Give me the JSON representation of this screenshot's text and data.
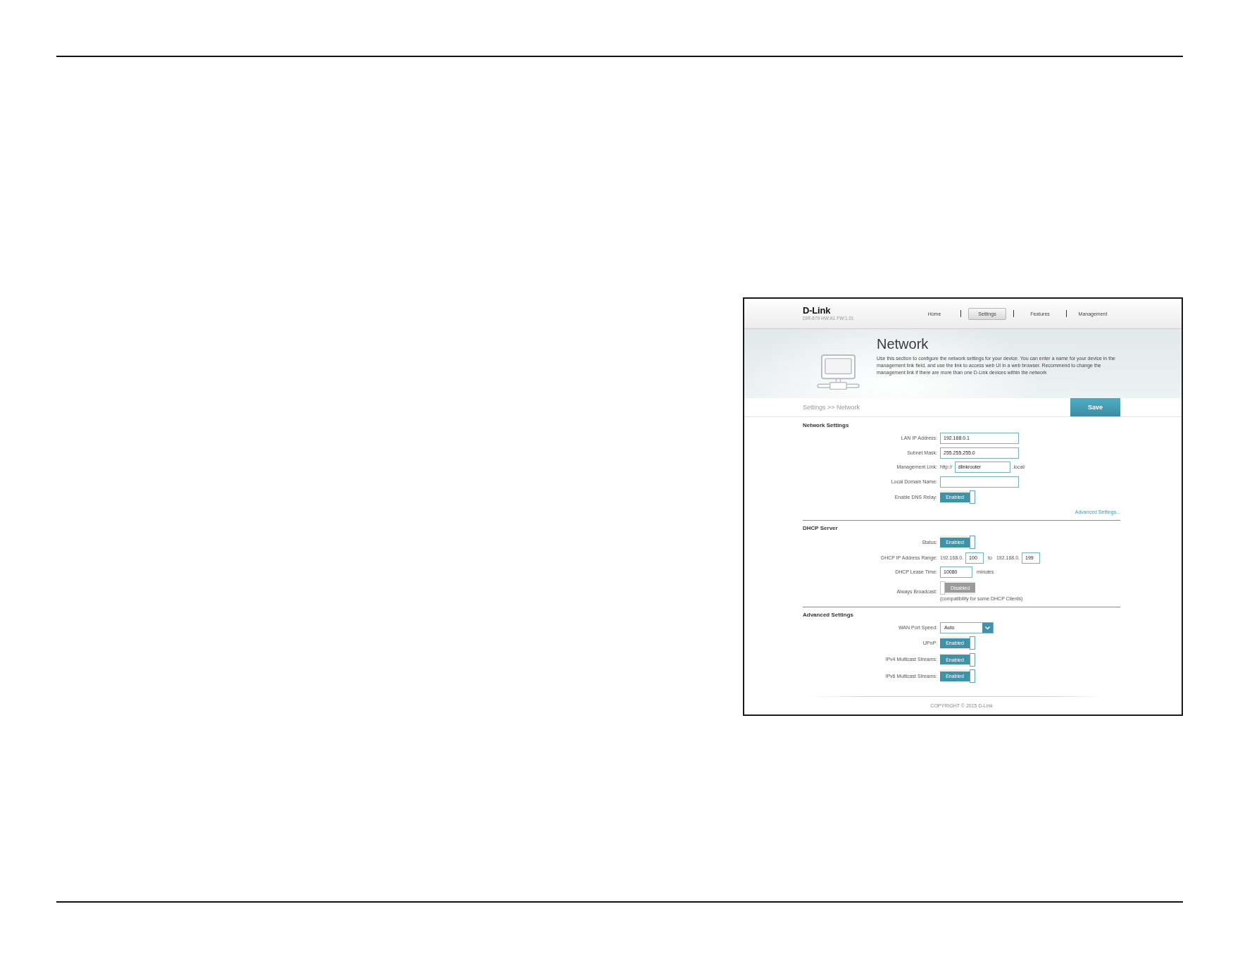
{
  "router_page": {
    "header": {
      "logo": "D-Link",
      "device_info": "DIR-879 HW:A1 FW:1.01",
      "nav": [
        {
          "label": "Home",
          "selected": false
        },
        {
          "label": "Settings",
          "selected": true
        },
        {
          "label": "Features",
          "selected": false
        },
        {
          "label": "Management",
          "selected": false
        }
      ]
    },
    "banner": {
      "title": "Network",
      "description": "Use this section to configure the network settings for your device. You can enter a name for your device in the management link field, and use the link to access web UI in a web browser. Recommend to change the management link if there are more than one D-Link devices within the network"
    },
    "breadcrumb": "Settings >> Network",
    "save_button": "Save",
    "sections": [
      {
        "title": "Network Settings",
        "rows": [
          {
            "kind": "text",
            "label": "LAN IP Address:",
            "value": "192.168.0.1"
          },
          {
            "kind": "text",
            "label": "Subnet Mask:",
            "value": "255.255.255.0"
          },
          {
            "kind": "link",
            "label": "Management Link:",
            "prefix": "http://",
            "value": "dlinkrouter",
            "suffix": ".local/"
          },
          {
            "kind": "text",
            "label": "Local Domain Name:"
          },
          {
            "kind": "toggle",
            "label": "Enable DNS Relay:",
            "on": true,
            "state_text": "Enabled"
          }
        ],
        "link": "Advanced Settings..."
      },
      {
        "title": "DHCP Server",
        "rows": [
          {
            "kind": "toggle",
            "label": "Status:",
            "on": true,
            "state_text": "Enabled"
          },
          {
            "kind": "range",
            "label": "DHCP IP Address Range:",
            "start_prefix": "192.168.0.",
            "start": "100",
            "joiner": "to",
            "end_prefix": "192.168.0.",
            "end": "199"
          },
          {
            "kind": "number",
            "label": "DHCP Lease Time:",
            "value": "10080",
            "unit": "minutes"
          },
          {
            "kind": "toggle",
            "label": "Always Broadcast:",
            "on": false,
            "state_text": "Disabled",
            "note": "(compatibility for some DHCP Clients)"
          }
        ]
      },
      {
        "title": "Advanced Settings",
        "rows": [
          {
            "kind": "select",
            "label": "WAN Port Speed:",
            "value": "Auto"
          },
          {
            "kind": "toggle",
            "label": "UPnP:",
            "on": true,
            "state_text": "Enabled"
          },
          {
            "kind": "toggle",
            "label": "IPv4 Multicast Streams:",
            "on": true,
            "state_text": "Enabled"
          },
          {
            "kind": "toggle",
            "label": "IPv6 Multicast Streams:",
            "on": true,
            "state_text": "Enabled"
          }
        ]
      }
    ],
    "footer": "COPYRIGHT © 2015 D-Link"
  }
}
